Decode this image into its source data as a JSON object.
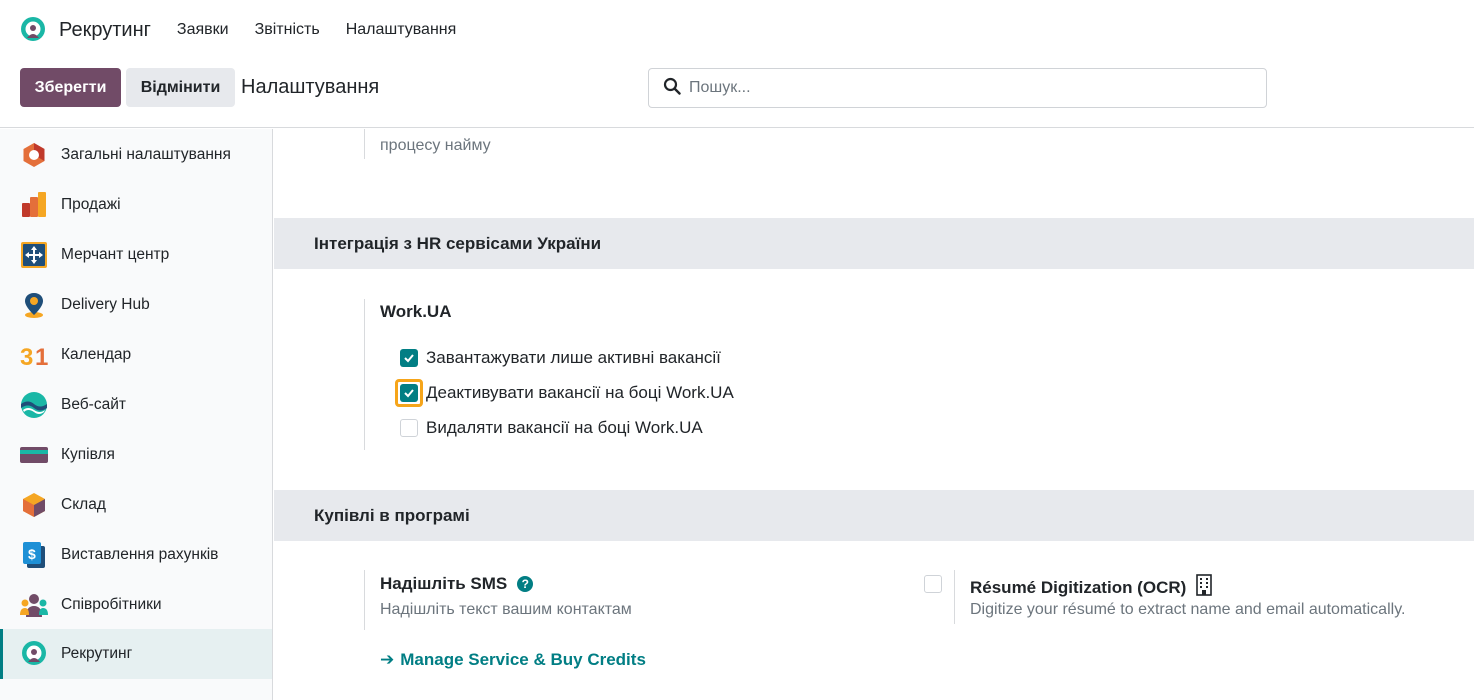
{
  "topnav": {
    "app_title": "Рекрутинг",
    "menu": [
      "Заявки",
      "Звітність",
      "Налаштування"
    ]
  },
  "control": {
    "save_label": "Зберегти",
    "cancel_label": "Відмінити",
    "title": "Налаштування",
    "search_placeholder": "Пошук..."
  },
  "sidebar": {
    "items": [
      {
        "label": "Загальні налаштування",
        "icon": "general-settings-icon"
      },
      {
        "label": "Продажі",
        "icon": "sales-icon"
      },
      {
        "label": "Мерчант центр",
        "icon": "merchant-center-icon"
      },
      {
        "label": "Delivery Hub",
        "icon": "delivery-hub-icon"
      },
      {
        "label": "Календар",
        "icon": "calendar-icon"
      },
      {
        "label": "Веб-сайт",
        "icon": "website-icon"
      },
      {
        "label": "Купівля",
        "icon": "purchase-icon"
      },
      {
        "label": "Склад",
        "icon": "inventory-icon"
      },
      {
        "label": "Виставлення рахунків",
        "icon": "invoicing-icon"
      },
      {
        "label": "Співробітники",
        "icon": "employees-icon"
      },
      {
        "label": "Рекрутинг",
        "icon": "recruitment-icon",
        "active": true
      }
    ]
  },
  "main": {
    "prev_text_tail": "процесу найму",
    "hr_section": {
      "title": "Інтеграція з HR сервісами України",
      "group_title": "Work.UA",
      "options": [
        {
          "label": "Завантажувати лише активні вакансії",
          "checked": true
        },
        {
          "label": "Деактивувати вакансії на боці Work.UA",
          "checked": true,
          "focused": true
        },
        {
          "label": "Видаляти вакансії на боці Work.UA",
          "checked": false
        }
      ]
    },
    "iap_section": {
      "title": "Купівлі в програмі",
      "sms": {
        "title": "Надішліть SMS",
        "description": "Надішліть текст вашим контактам",
        "link": "Manage Service & Buy Credits"
      },
      "ocr": {
        "title": "Résumé Digitization (OCR)",
        "description": "Digitize your résumé to extract name and email automatically.",
        "checked": false
      }
    }
  },
  "colors": {
    "primary": "#714b67",
    "accent": "#017e84",
    "focus": "#f6a51a"
  }
}
